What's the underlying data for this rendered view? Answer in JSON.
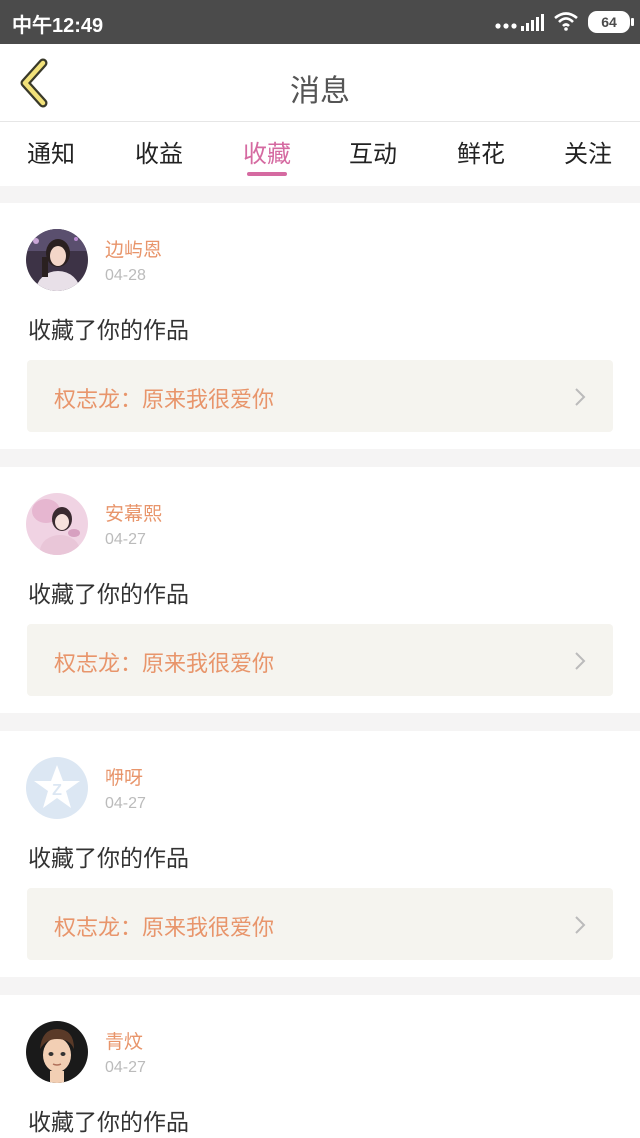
{
  "status": {
    "time": "中午12:49",
    "battery": "64"
  },
  "header": {
    "title": "消息"
  },
  "tabs": [
    {
      "label": "通知"
    },
    {
      "label": "收益"
    },
    {
      "label": "收藏"
    },
    {
      "label": "互动"
    },
    {
      "label": "鲜花"
    },
    {
      "label": "关注"
    }
  ],
  "active_tab": "收藏",
  "colors": {
    "accent": "#d56aa1",
    "name": "#e8956b",
    "work_bg": "#f5f4ef"
  },
  "messages": [
    {
      "name": "边屿恩",
      "date": "04-28",
      "action": "收藏了你的作品",
      "work": "权志龙：原来我很爱你",
      "avatar": "photo-girl-icon"
    },
    {
      "name": "安幕熙",
      "date": "04-27",
      "action": "收藏了你的作品",
      "work": "权志龙：原来我很爱你",
      "avatar": "photo-pink-girl-icon"
    },
    {
      "name": "咿呀",
      "date": "04-27",
      "action": "收藏了你的作品",
      "work": "权志龙：原来我很爱你",
      "avatar": "default-star-avatar-icon"
    },
    {
      "name": "青炆",
      "date": "04-27",
      "action": "收藏了你的作品"
    }
  ]
}
